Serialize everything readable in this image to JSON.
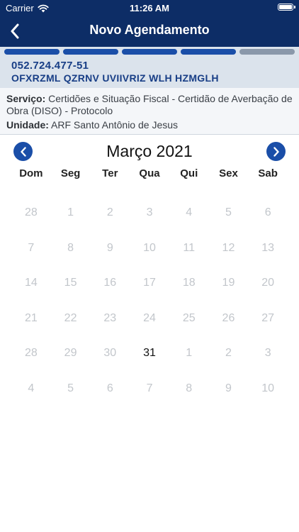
{
  "status_bar": {
    "carrier": "Carrier",
    "time": "11:26 AM"
  },
  "nav": {
    "title": "Novo Agendamento"
  },
  "progress": {
    "steps_total": 5,
    "steps_completed": 4
  },
  "user": {
    "cpf": "052.724.477-51",
    "name": "OFXRZML QZRNV UVIIVRIZ WLH HZMGLH"
  },
  "service": {
    "service_label": "Serviço:",
    "service_value": "Certidões e Situação Fiscal - Certidão de Averbação de Obra (DISO) - Protocolo",
    "unit_label": "Unidade:",
    "unit_value": "ARF Santo Antônio de Jesus"
  },
  "calendar": {
    "month_title": "Março 2021",
    "weekdays": [
      "Dom",
      "Seg",
      "Ter",
      "Qua",
      "Qui",
      "Sex",
      "Sab"
    ],
    "weeks": [
      [
        {
          "d": "28",
          "a": false
        },
        {
          "d": "1",
          "a": false
        },
        {
          "d": "2",
          "a": false
        },
        {
          "d": "3",
          "a": false
        },
        {
          "d": "4",
          "a": false
        },
        {
          "d": "5",
          "a": false
        },
        {
          "d": "6",
          "a": false
        }
      ],
      [
        {
          "d": "7",
          "a": false
        },
        {
          "d": "8",
          "a": false
        },
        {
          "d": "9",
          "a": false
        },
        {
          "d": "10",
          "a": false
        },
        {
          "d": "11",
          "a": false
        },
        {
          "d": "12",
          "a": false
        },
        {
          "d": "13",
          "a": false
        }
      ],
      [
        {
          "d": "14",
          "a": false
        },
        {
          "d": "15",
          "a": false
        },
        {
          "d": "16",
          "a": false
        },
        {
          "d": "17",
          "a": false
        },
        {
          "d": "18",
          "a": false
        },
        {
          "d": "19",
          "a": false
        },
        {
          "d": "20",
          "a": false
        }
      ],
      [
        {
          "d": "21",
          "a": false
        },
        {
          "d": "22",
          "a": false
        },
        {
          "d": "23",
          "a": false
        },
        {
          "d": "24",
          "a": false
        },
        {
          "d": "25",
          "a": false
        },
        {
          "d": "26",
          "a": false
        },
        {
          "d": "27",
          "a": false
        }
      ],
      [
        {
          "d": "28",
          "a": false
        },
        {
          "d": "29",
          "a": false
        },
        {
          "d": "30",
          "a": false
        },
        {
          "d": "31",
          "a": true
        },
        {
          "d": "1",
          "a": false
        },
        {
          "d": "2",
          "a": false
        },
        {
          "d": "3",
          "a": false
        }
      ],
      [
        {
          "d": "4",
          "a": false
        },
        {
          "d": "5",
          "a": false
        },
        {
          "d": "6",
          "a": false
        },
        {
          "d": "7",
          "a": false
        },
        {
          "d": "8",
          "a": false
        },
        {
          "d": "9",
          "a": false
        },
        {
          "d": "10",
          "a": false
        }
      ]
    ]
  },
  "colors": {
    "header_bg": "#0d2d66",
    "accent": "#1a4ea8",
    "user_text": "#183e86",
    "disabled_day": "#c2c6cb"
  }
}
